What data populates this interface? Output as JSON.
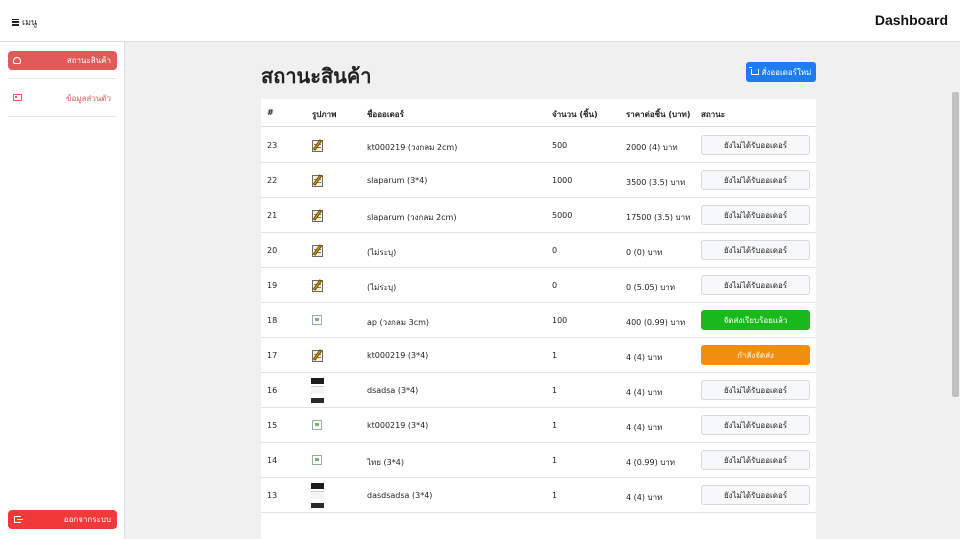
{
  "topbar": {
    "menu_label": "เมนู",
    "brand": "Dashboard"
  },
  "sidebar": {
    "status_label": "สถานะสินค้า",
    "profile_label": "ข้อมูลส่วนตัว",
    "logout_label": "ออกจากระบบ"
  },
  "page": {
    "title": "สถานะสินค้า",
    "new_order_label": "สั่งออเดอร์ใหม่"
  },
  "table": {
    "headers": [
      "#",
      "รูปภาพ",
      "ชื่อออเดอร์",
      "จำนวน (ชิ้น)",
      "ราคาต่อชิ้น (บาท)",
      "สถานะ"
    ],
    "rows": [
      {
        "id": "23",
        "image": "doc-icon",
        "name": "kt000219 (วงกลม 2cm)",
        "qty": "500",
        "price": "2000 (4) บาท",
        "status": "ยังไม่ได้รับออเดอร์",
        "status_type": "pending"
      },
      {
        "id": "22",
        "image": "doc-icon",
        "name": "slaparum (3*4)",
        "qty": "1000",
        "price": "3500 (3.5) บาท",
        "status": "ยังไม่ได้รับออเดอร์",
        "status_type": "pending"
      },
      {
        "id": "21",
        "image": "doc-icon",
        "name": "slaparum (วงกลม 2cm)",
        "qty": "5000",
        "price": "17500 (3.5) บาท",
        "status": "ยังไม่ได้รับออเดอร์",
        "status_type": "pending"
      },
      {
        "id": "20",
        "image": "doc-icon",
        "name": "(ไม่ระบุ)",
        "qty": "0",
        "price": "0 (0) บาท",
        "status": "ยังไม่ได้รับออเดอร์",
        "status_type": "pending"
      },
      {
        "id": "19",
        "image": "doc-icon",
        "name": "(ไม่ระบุ)",
        "qty": "0",
        "price": "0 (5.05) บาท",
        "status": "ยังไม่ได้รับออเดอร์",
        "status_type": "pending"
      },
      {
        "id": "18",
        "image": "broken-image-icon",
        "name": "ap (วงกลม 3cm)",
        "qty": "100",
        "price": "400 (0.99) บาท",
        "status": "จัดส่งเรียบร้อยแล้ว",
        "status_type": "done"
      },
      {
        "id": "17",
        "image": "doc-icon",
        "name": "kt000219 (3*4)",
        "qty": "1",
        "price": "4 (4) บาท",
        "status": "กำลังจัดส่ง",
        "status_type": "shipping"
      },
      {
        "id": "16",
        "image": "photo-thumbnail",
        "name": "dsadsa (3*4)",
        "qty": "1",
        "price": "4 (4) บาท",
        "status": "ยังไม่ได้รับออเดอร์",
        "status_type": "pending"
      },
      {
        "id": "15",
        "image": "broken-image-icon",
        "name": "kt000219 (3*4)",
        "qty": "1",
        "price": "4 (4) บาท",
        "status": "ยังไม่ได้รับออเดอร์",
        "status_type": "pending"
      },
      {
        "id": "14",
        "image": "broken-image-icon",
        "name": "ไทย (3*4)",
        "qty": "1",
        "price": "4 (0.99) บาท",
        "status": "ยังไม่ได้รับออเดอร์",
        "status_type": "pending"
      },
      {
        "id": "13",
        "image": "photo-thumbnail",
        "name": "dasdsadsa (3*4)",
        "qty": "1",
        "price": "4 (4) บาท",
        "status": "ยังไม่ได้รับออเดอร์",
        "status_type": "pending"
      }
    ]
  },
  "colors": {
    "accent_red": "#e05a5a",
    "primary_blue": "#1e7bf0",
    "done_green": "#19b81c",
    "shipping_orange": "#ef8e0f"
  }
}
